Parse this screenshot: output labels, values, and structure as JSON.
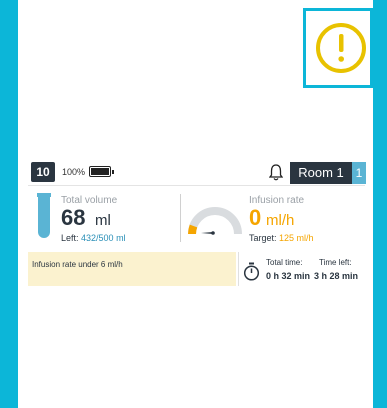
{
  "header": {
    "bed_number": "10",
    "battery_percent": "100%",
    "room_label": "Room 1",
    "room_index": "1"
  },
  "volume": {
    "label": "Total volume",
    "value": "68",
    "unit": "ml",
    "left_prefix": "Left:",
    "left_value": "432/500 ml"
  },
  "rate": {
    "label": "Infusion rate",
    "value": "0",
    "unit": "ml/h",
    "target_prefix": "Target:",
    "target_value": "125 ml/h"
  },
  "notice": {
    "message": "Infusion rate under 6 ml/h"
  },
  "times": {
    "total_label": "Total time:",
    "total_value": "0 h 32 min",
    "left_label": "Time left:",
    "left_value": "3 h 28 min"
  },
  "colors": {
    "accent": "#0cb6d8",
    "warning": "#f5a500",
    "alert_icon": "#e8c200",
    "dark": "#2a3540"
  },
  "icons": [
    "alert-circle-icon",
    "battery-icon",
    "bell-icon",
    "syringe-icon",
    "gauge-icon",
    "timer-icon"
  ]
}
